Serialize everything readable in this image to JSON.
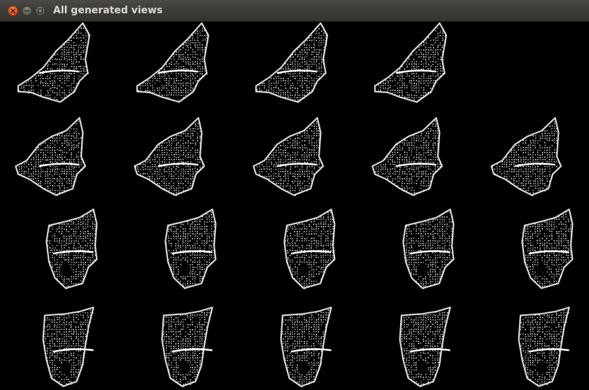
{
  "window": {
    "title": "All generated views"
  },
  "titlebar_buttons": {
    "close_icon": "close-icon",
    "minimize_icon": "minimize-icon",
    "maximize_icon": "maximize-icon",
    "close_color": "#e0551f"
  },
  "grid": {
    "rows": 4,
    "columns": 5,
    "views_per_row": [
      4,
      5,
      5,
      5
    ],
    "view_color": "#ffffff",
    "background_color": "#000000"
  }
}
